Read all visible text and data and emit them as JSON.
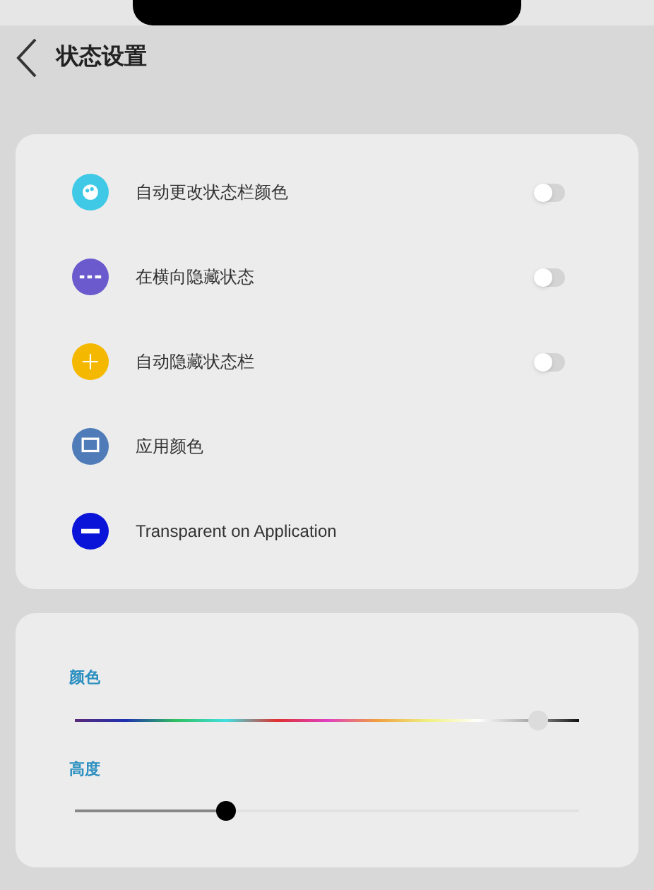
{
  "header": {
    "title": "状态设置"
  },
  "settings": [
    {
      "label": "自动更改状态栏颜色",
      "kind": "toggle",
      "on": false,
      "color": "#3fc9e6"
    },
    {
      "label": "在横向隐藏状态",
      "kind": "toggle",
      "on": false,
      "color": "#6a5acd"
    },
    {
      "label": "自动隐藏状态栏",
      "kind": "toggle",
      "on": false,
      "color": "#f5b800"
    },
    {
      "label": "应用颜色",
      "kind": "plain",
      "color": "#4f7cb8"
    },
    {
      "label": "Transparent on Application",
      "kind": "plain",
      "color": "#0a14d8"
    }
  ],
  "sliders": [
    {
      "label": "颜色",
      "kind": "spectrum",
      "level": 0.92
    },
    {
      "label": "高度",
      "kind": "plain",
      "level": 0.3
    }
  ]
}
